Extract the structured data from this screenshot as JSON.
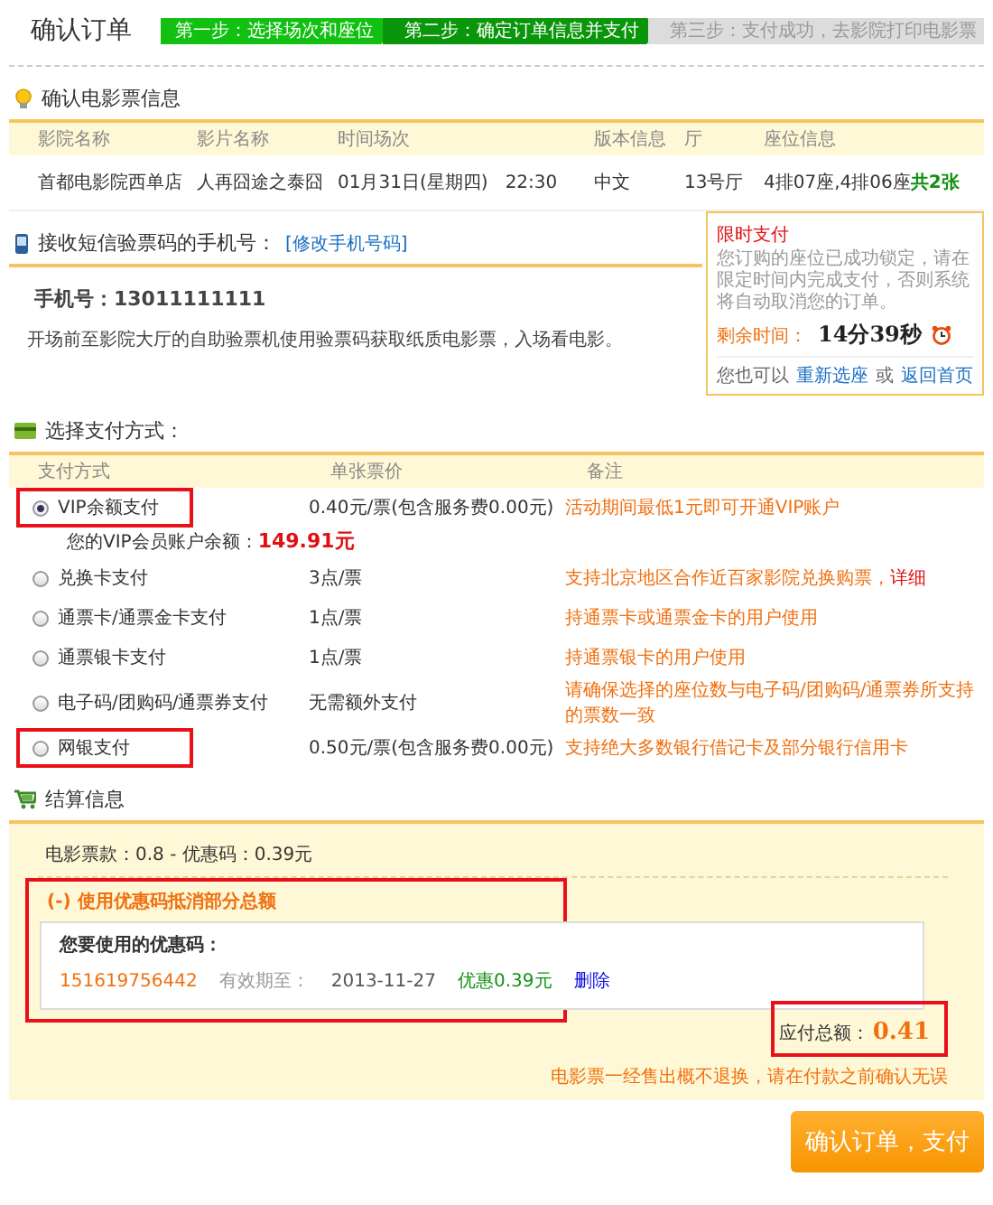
{
  "page_title": "确认订单",
  "steps": [
    {
      "label": "第一步：选择场次和座位",
      "done": true,
      "selected": false
    },
    {
      "label": "第二步：确定订单信息并支付",
      "done": false,
      "selected": true
    },
    {
      "label": "第三步：支付成功，去影院打印电影票",
      "done": false,
      "selected": false
    }
  ],
  "ticket_section": {
    "title": "确认电影票信息",
    "columns": [
      "影院名称",
      "影片名称",
      "时间场次",
      "版本信息",
      "厅",
      "座位信息"
    ],
    "row": {
      "cinema": "首都电影院西单店",
      "film": "人再囧途之泰囧",
      "date": "01月31日(星期四)",
      "time": "22:30",
      "version": "中文",
      "hall": "13号厅",
      "seats": "4排07座,4排06座",
      "count": "共2张"
    }
  },
  "phone_section": {
    "title": "接收短信验票码的手机号：",
    "edit_link": "[修改手机号码]",
    "phone": "手机号：13011111111",
    "note": "开场前至影院大厅的自助验票机使用验票码获取纸质电影票，入场看电影。"
  },
  "timer_box": {
    "title": "限时支付",
    "message": "您订购的座位已成功锁定，请在限定时间内完成支付，否则系统将自动取消您的订单。",
    "remaining_label": "剩余时间：",
    "remaining": "14分39秒",
    "alt_prefix": "您也可以",
    "reselect_link": "重新选座",
    "or": "或",
    "home_link": "返回首页"
  },
  "payment_section": {
    "title": "选择支付方式：",
    "columns": [
      "支付方式",
      "单张票价",
      "备注"
    ],
    "methods": [
      {
        "name": "VIP余额支付",
        "price": "0.40元/票(包含服务费0.00元)",
        "remark": "活动期间最低1元即可开通VIP账户",
        "selected": true,
        "highlighted": true,
        "balance_label": "您的VIP会员账户余额：",
        "balance": "149.91元"
      },
      {
        "name": "兑换卡支付",
        "price": "3点/票",
        "remark": "支持北京地区合作近百家影院兑换购票，",
        "remark_link": "详细",
        "selected": false,
        "highlighted": false
      },
      {
        "name": "通票卡/通票金卡支付",
        "price": "1点/票",
        "remark": "持通票卡或通票金卡的用户使用",
        "selected": false,
        "highlighted": false
      },
      {
        "name": "通票银卡支付",
        "price": "1点/票",
        "remark": "持通票银卡的用户使用",
        "selected": false,
        "highlighted": false
      },
      {
        "name": "电子码/团购码/通票券支付",
        "price": "无需额外支付",
        "remark": "请确保选择的座位数与电子码/团购码/通票券所支持的票数一致",
        "selected": false,
        "highlighted": false
      },
      {
        "name": "网银支付",
        "price": "0.50元/票(包含服务费0.00元)",
        "remark": "支持绝大多数银行借记卡及部分银行信用卡",
        "selected": false,
        "highlighted": true
      }
    ]
  },
  "settlement": {
    "title": "结算信息",
    "summary": "电影票款：0.8 - 优惠码：0.39元",
    "coupon": {
      "title": "(-) 使用优惠码抵消部分总额",
      "highlighted": true,
      "used_label": "您要使用的优惠码：",
      "code": "151619756442",
      "expiry_label": "有效期至：",
      "expiry": "2013-11-27",
      "discount": "优惠0.39元",
      "delete": "删除"
    },
    "total_label": "应付总额：",
    "total": "0.41",
    "total_highlighted": true,
    "warning": "电影票一经售出概不退换，请在付款之前确认无误"
  },
  "submit_button": "确认订单，支付"
}
